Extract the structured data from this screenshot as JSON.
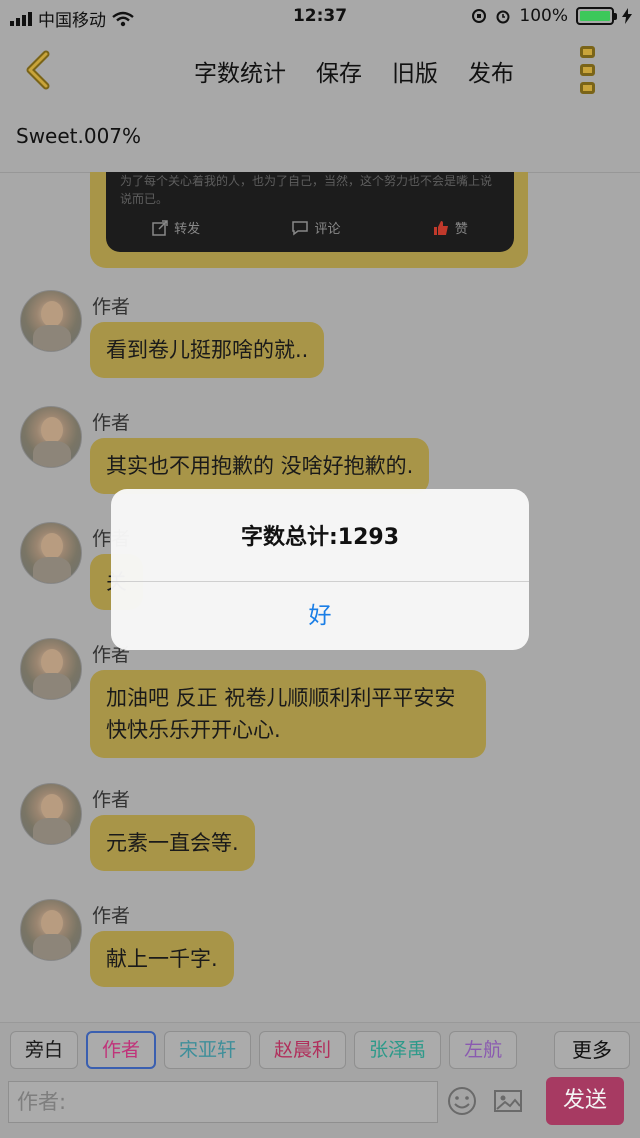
{
  "status_bar": {
    "carrier": "中国移动",
    "time": "12:37",
    "battery": "100%"
  },
  "navbar": {
    "items": [
      "字数统计",
      "保存",
      "旧版",
      "发布"
    ]
  },
  "story_title": "Sweet.007%",
  "embed": {
    "text": "为了每个关心着我的人，也为了自己，当然，这个努力也不会是嘴上说说而已。",
    "actions": [
      "转发",
      "评论",
      "赞"
    ]
  },
  "messages": [
    {
      "author": "作者",
      "text": "看到卷儿挺那啥的就.."
    },
    {
      "author": "作者",
      "text": "其实也不用抱歉的 没啥好抱歉的."
    },
    {
      "author": "作者",
      "text": "关"
    },
    {
      "author": "作者",
      "text": "加油吧 反正 祝卷儿顺顺利利平平安安快快乐乐开开心心."
    },
    {
      "author": "作者",
      "text": "元素一直会等."
    },
    {
      "author": "作者",
      "text": "献上一千字."
    }
  ],
  "alert": {
    "title": "字数总计:1293",
    "ok": "好"
  },
  "role_tabs": [
    {
      "label": "旁白",
      "color": "#1a1a1a"
    },
    {
      "label": "作者",
      "color": "#c0337a"
    },
    {
      "label": "宋亚轩",
      "color": "#3f8f9a"
    },
    {
      "label": "赵晨利",
      "color": "#b0305c"
    },
    {
      "label": "张泽禹",
      "color": "#2e9a8a"
    },
    {
      "label": "左航",
      "color": "#8a5ab0"
    }
  ],
  "more_label": "更多",
  "input": {
    "placeholder": "作者:"
  },
  "send_label": "发送",
  "colors": {
    "bubble": "#a89548",
    "send": "#a73a62",
    "accent": "#1a7ee6"
  }
}
